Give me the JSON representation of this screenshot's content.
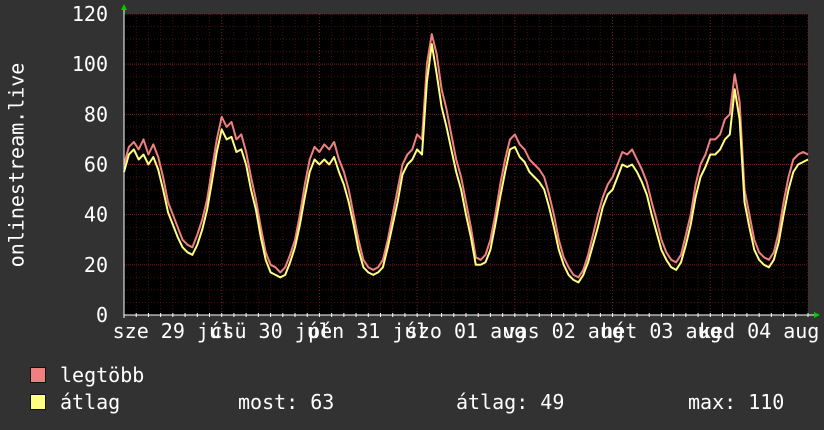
{
  "chart_data": {
    "type": "line",
    "vertical_label": "onlinestream.live",
    "ylim": [
      0,
      120
    ],
    "y_ticks": [
      0,
      20,
      40,
      60,
      80,
      100,
      120
    ],
    "x_range_days": [
      0,
      7
    ],
    "x_tick_labels": [
      {
        "day": 0.5,
        "label": "sze 29 júl"
      },
      {
        "day": 1.5,
        "label": "csü 30 júl"
      },
      {
        "day": 2.5,
        "label": "pén 31 júl"
      },
      {
        "day": 3.5,
        "label": "szo 01 aug"
      },
      {
        "day": 4.5,
        "label": "vas 02 aug"
      },
      {
        "day": 5.5,
        "label": "hét 03 aug"
      },
      {
        "day": 6.5,
        "label": "ked 04 aug"
      }
    ],
    "grid": true,
    "colors": {
      "max": "#f08080",
      "avg": "#ffff80",
      "background": "#323232",
      "plot_bg": "#000000",
      "grid": "#7a2020"
    },
    "series": [
      {
        "name": "legtöbb",
        "x": [
          0,
          0.05,
          0.1,
          0.15,
          0.2,
          0.25,
          0.3,
          0.35,
          0.4,
          0.45,
          0.5,
          0.55,
          0.6,
          0.65,
          0.7,
          0.75,
          0.8,
          0.85,
          0.9,
          0.95,
          1,
          1.05,
          1.1,
          1.15,
          1.2,
          1.25,
          1.3,
          1.35,
          1.4,
          1.45,
          1.5,
          1.55,
          1.6,
          1.65,
          1.7,
          1.75,
          1.8,
          1.85,
          1.9,
          1.95,
          2,
          2.05,
          2.1,
          2.15,
          2.2,
          2.25,
          2.3,
          2.35,
          2.4,
          2.45,
          2.5,
          2.55,
          2.6,
          2.65,
          2.7,
          2.75,
          2.8,
          2.85,
          2.9,
          2.95,
          3,
          3.05,
          3.1,
          3.15,
          3.2,
          3.25,
          3.3,
          3.35,
          3.4,
          3.45,
          3.5,
          3.55,
          3.6,
          3.65,
          3.7,
          3.75,
          3.8,
          3.85,
          3.9,
          3.95,
          4,
          4.05,
          4.1,
          4.15,
          4.2,
          4.25,
          4.3,
          4.35,
          4.4,
          4.45,
          4.5,
          4.55,
          4.6,
          4.65,
          4.7,
          4.75,
          4.8,
          4.85,
          4.9,
          4.95,
          5,
          5.05,
          5.1,
          5.15,
          5.2,
          5.25,
          5.3,
          5.35,
          5.4,
          5.45,
          5.5,
          5.55,
          5.6,
          5.65,
          5.7,
          5.75,
          5.8,
          5.85,
          5.9,
          5.95,
          6,
          6.05,
          6.1,
          6.15,
          6.2,
          6.25,
          6.3,
          6.35,
          6.4,
          6.45,
          6.5,
          6.55,
          6.6,
          6.65,
          6.7,
          6.75,
          6.8,
          6.85,
          6.9,
          6.95,
          7
        ],
        "values": [
          60,
          67,
          69,
          66,
          70,
          64,
          68,
          63,
          55,
          45,
          40,
          35,
          30,
          28,
          27,
          32,
          38,
          46,
          58,
          70,
          79,
          75,
          77,
          70,
          72,
          65,
          55,
          46,
          35,
          25,
          20,
          19,
          17,
          19,
          24,
          30,
          40,
          52,
          62,
          67,
          65,
          68,
          66,
          69,
          62,
          57,
          50,
          40,
          30,
          22,
          19,
          18,
          19,
          22,
          30,
          40,
          50,
          60,
          64,
          66,
          72,
          70,
          100,
          112,
          104,
          90,
          82,
          72,
          62,
          55,
          45,
          35,
          23,
          22,
          24,
          30,
          40,
          52,
          62,
          70,
          72,
          68,
          66,
          62,
          60,
          58,
          55,
          48,
          40,
          30,
          23,
          19,
          16,
          15,
          18,
          24,
          32,
          40,
          47,
          52,
          55,
          60,
          65,
          64,
          66,
          62,
          58,
          53,
          45,
          38,
          30,
          25,
          22,
          21,
          24,
          32,
          40,
          52,
          60,
          64,
          70,
          70,
          72,
          78,
          80,
          96,
          85,
          50,
          40,
          30,
          25,
          23,
          22,
          25,
          33,
          45,
          55,
          62,
          64,
          65,
          64
        ],
        "note_omitted": false
      },
      {
        "name": "átlag",
        "x": [
          0,
          0.05,
          0.1,
          0.15,
          0.2,
          0.25,
          0.3,
          0.35,
          0.4,
          0.45,
          0.5,
          0.55,
          0.6,
          0.65,
          0.7,
          0.75,
          0.8,
          0.85,
          0.9,
          0.95,
          1,
          1.05,
          1.1,
          1.15,
          1.2,
          1.25,
          1.3,
          1.35,
          1.4,
          1.45,
          1.5,
          1.55,
          1.6,
          1.65,
          1.7,
          1.75,
          1.8,
          1.85,
          1.9,
          1.95,
          2,
          2.05,
          2.1,
          2.15,
          2.2,
          2.25,
          2.3,
          2.35,
          2.4,
          2.45,
          2.5,
          2.55,
          2.6,
          2.65,
          2.7,
          2.75,
          2.8,
          2.85,
          2.9,
          2.95,
          3,
          3.05,
          3.1,
          3.15,
          3.2,
          3.25,
          3.3,
          3.35,
          3.4,
          3.45,
          3.5,
          3.55,
          3.6,
          3.65,
          3.7,
          3.75,
          3.8,
          3.85,
          3.9,
          3.95,
          4,
          4.05,
          4.1,
          4.15,
          4.2,
          4.25,
          4.3,
          4.35,
          4.4,
          4.45,
          4.5,
          4.55,
          4.6,
          4.65,
          4.7,
          4.75,
          4.8,
          4.85,
          4.9,
          4.95,
          5,
          5.05,
          5.1,
          5.15,
          5.2,
          5.25,
          5.3,
          5.35,
          5.4,
          5.45,
          5.5,
          5.55,
          5.6,
          5.65,
          5.7,
          5.75,
          5.8,
          5.85,
          5.9,
          5.95,
          6,
          6.05,
          6.1,
          6.15,
          6.2,
          6.25,
          6.3,
          6.35,
          6.4,
          6.45,
          6.5,
          6.55,
          6.6,
          6.65,
          6.7,
          6.75,
          6.8,
          6.85,
          6.9,
          6.95,
          7
        ],
        "values": [
          57,
          64,
          66,
          62,
          64,
          60,
          63,
          58,
          50,
          41,
          36,
          31,
          27,
          25,
          24,
          28,
          34,
          42,
          53,
          65,
          74,
          70,
          71,
          65,
          66,
          60,
          50,
          42,
          31,
          22,
          17,
          16,
          15,
          16,
          21,
          27,
          36,
          47,
          57,
          62,
          60,
          62,
          60,
          63,
          57,
          52,
          45,
          36,
          26,
          19,
          17,
          16,
          17,
          19,
          27,
          36,
          45,
          56,
          60,
          62,
          66,
          64,
          93,
          108,
          96,
          83,
          75,
          66,
          57,
          50,
          40,
          31,
          20,
          20,
          21,
          26,
          36,
          47,
          57,
          66,
          67,
          63,
          61,
          57,
          55,
          53,
          50,
          43,
          35,
          26,
          20,
          16,
          14,
          13,
          16,
          21,
          28,
          35,
          43,
          48,
          50,
          55,
          60,
          59,
          60,
          57,
          53,
          48,
          40,
          33,
          26,
          22,
          19,
          18,
          21,
          28,
          36,
          47,
          55,
          59,
          64,
          64,
          66,
          70,
          72,
          90,
          78,
          45,
          35,
          26,
          22,
          20,
          19,
          22,
          29,
          40,
          50,
          57,
          60,
          61,
          62
        ]
      }
    ]
  },
  "legend": [
    {
      "label": "legtöbb",
      "color": "#f08080"
    },
    {
      "label": "átlag",
      "color": "#ffff80"
    }
  ],
  "stats": {
    "most": "most: 63",
    "atlag": "átlag: 49",
    "max": "max: 110"
  }
}
